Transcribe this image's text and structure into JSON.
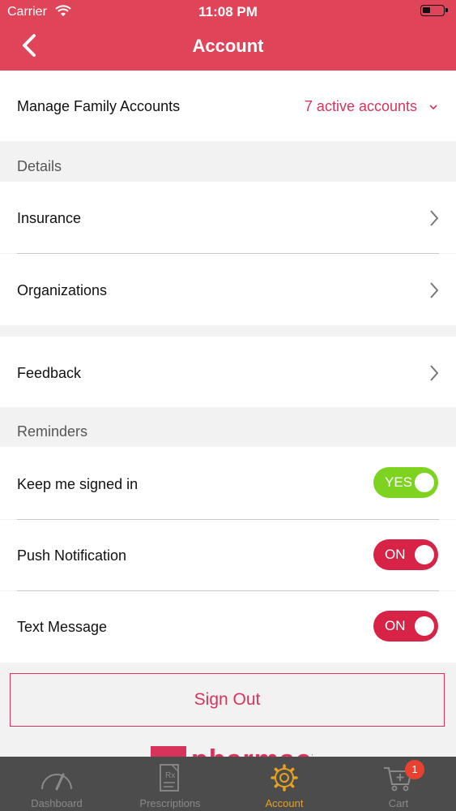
{
  "status_bar": {
    "carrier": "Carrier",
    "time": "11:08 PM"
  },
  "nav": {
    "title": "Account"
  },
  "family": {
    "label": "Manage Family Accounts",
    "value": "7 active accounts"
  },
  "details": {
    "header": "Details",
    "items": [
      {
        "label": "Insurance"
      },
      {
        "label": "Organizations"
      }
    ]
  },
  "feedback": {
    "label": "Feedback"
  },
  "reminders": {
    "header": "Reminders",
    "items": [
      {
        "label": "Keep me signed in",
        "toggle": "YES",
        "color": "#7ed321"
      },
      {
        "label": "Push Notification",
        "toggle": "ON",
        "color": "#d72345"
      },
      {
        "label": "Text Message",
        "toggle": "ON",
        "color": "#d72345"
      }
    ]
  },
  "signout": {
    "label": "Sign Out"
  },
  "brand": {
    "name": "pharmacy"
  },
  "tabs": [
    {
      "label": "Dashboard",
      "icon": "gauge-icon"
    },
    {
      "label": "Prescriptions",
      "icon": "rx-document-icon"
    },
    {
      "label": "Account",
      "icon": "gear-icon",
      "active": true
    },
    {
      "label": "Cart",
      "icon": "cart-icon",
      "badge": "1"
    }
  ],
  "colors": {
    "header": "#e04458",
    "accent": "#d8345b",
    "active_tab": "#e6a31e",
    "tabbar": "#4c4c4c"
  }
}
